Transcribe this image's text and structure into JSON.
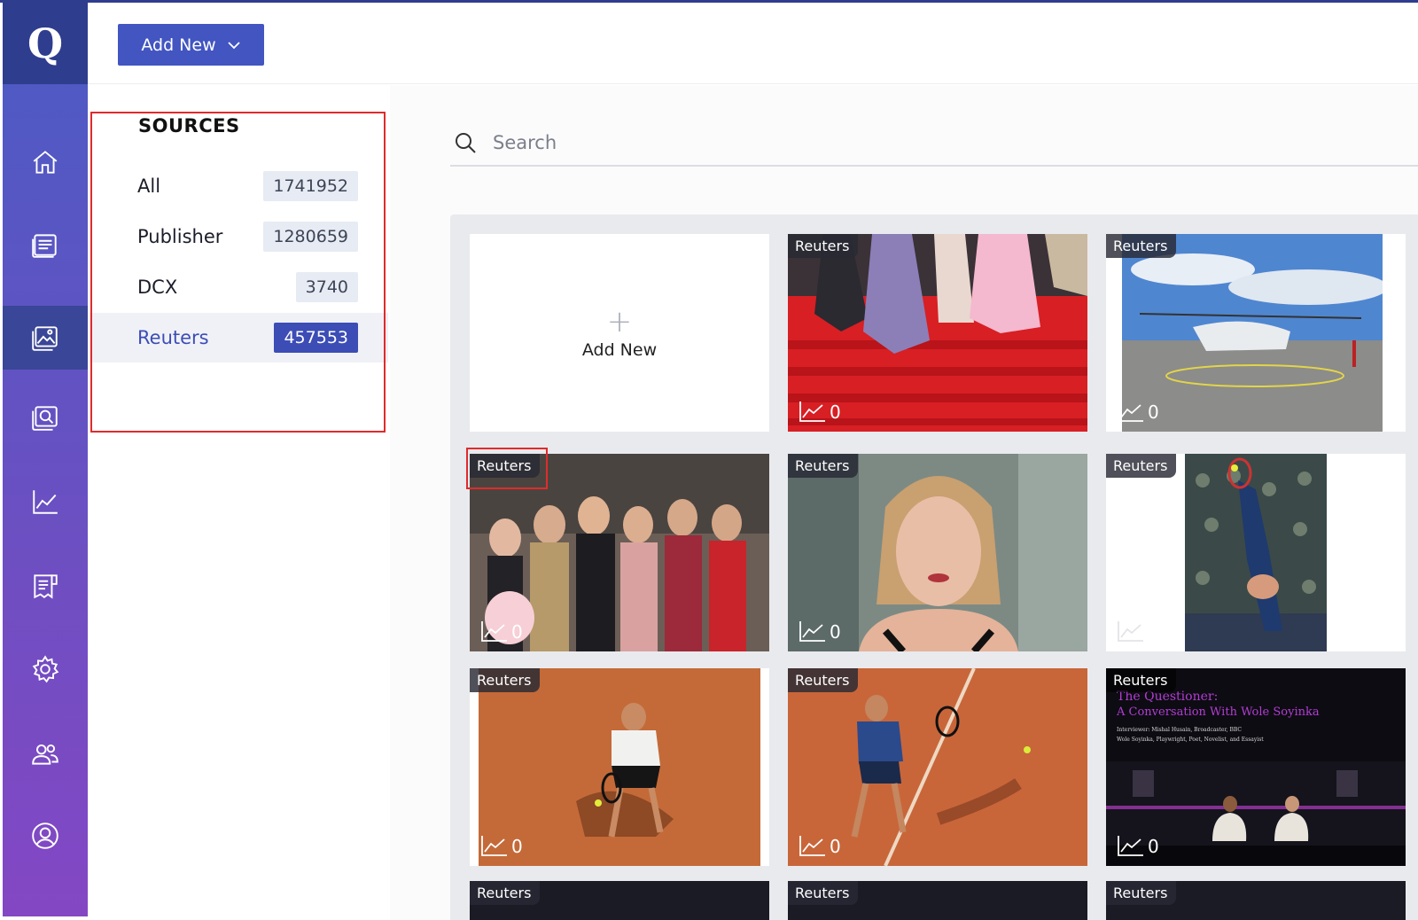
{
  "header": {
    "add_new_label": "Add New"
  },
  "nav": {
    "logo_text": "Q",
    "items": [
      {
        "icon": "home-icon"
      },
      {
        "icon": "stories-icon"
      },
      {
        "icon": "media-gallery-icon"
      },
      {
        "icon": "image-search-icon"
      },
      {
        "icon": "analytics-icon"
      },
      {
        "icon": "forms-icon"
      },
      {
        "icon": "settings-gear-icon"
      },
      {
        "icon": "users-icon"
      },
      {
        "icon": "profile-icon"
      }
    ],
    "active_index": 2
  },
  "sources": {
    "title": "SOURCES",
    "items": [
      {
        "name": "All",
        "count": "1741952"
      },
      {
        "name": "Publisher",
        "count": "1280659"
      },
      {
        "name": "DCX",
        "count": "3740"
      },
      {
        "name": "Reuters",
        "count": "457553"
      }
    ],
    "active": "Reuters"
  },
  "search": {
    "placeholder": "Search"
  },
  "gallery": {
    "add_new_label": "Add New",
    "cards": [
      {
        "source": "Reuters",
        "views": "0",
        "scene": "red-carpet-stairs"
      },
      {
        "source": "Reuters",
        "views": "0",
        "scene": "helicopter-on-helipad"
      },
      {
        "source": "Reuters",
        "views": "0",
        "scene": "red-carpet-group"
      },
      {
        "source": "Reuters",
        "views": "0",
        "scene": "portrait-woman"
      },
      {
        "source": "Reuters",
        "views": "",
        "scene": "tennis-serve"
      },
      {
        "source": "Reuters",
        "views": "0",
        "scene": "clay-court-player-1"
      },
      {
        "source": "Reuters",
        "views": "0",
        "scene": "clay-court-player-2"
      },
      {
        "source": "Reuters",
        "views": "0",
        "scene": "stage-conversation",
        "title_line1": "The Questioner:",
        "title_line2": "A Conversation With Wole Soyinka",
        "sub_line1": "Interviewer: Mishal Husain, Broadcaster, BBC",
        "sub_line2": "Wole Soyinka, Playwright, Poet, Novelist, and Essayist"
      },
      {
        "source": "Reuters",
        "views": "",
        "scene": "dark"
      },
      {
        "source": "Reuters",
        "views": "",
        "scene": "dark"
      },
      {
        "source": "Reuters",
        "views": "",
        "scene": "dark"
      }
    ]
  },
  "colors": {
    "accent": "#4255c1",
    "highlight": "#e02b2b",
    "rail_top": "#4a5bc4",
    "rail_bottom": "#8447c4"
  }
}
